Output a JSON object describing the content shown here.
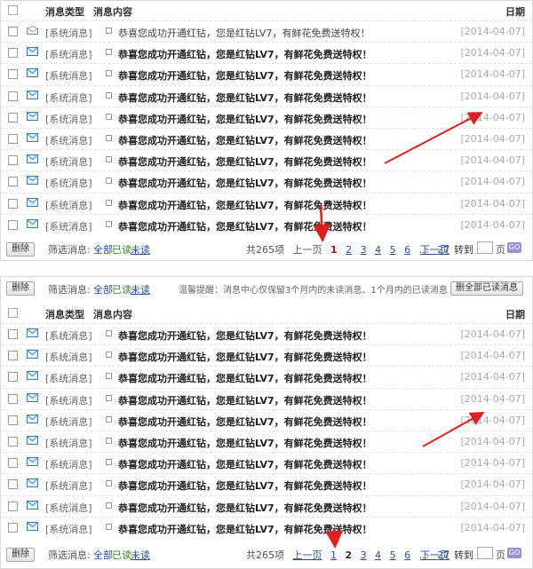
{
  "header": {
    "type": "消息类型",
    "content": "消息内容",
    "date": "日期"
  },
  "top": {
    "rows": [
      {
        "type": "[系统消息]",
        "msg": "恭喜您成功开通红钻，您是红钻LV7，有鲜花免费送特权！",
        "date": "[2014-04-07]",
        "read": true
      },
      {
        "type": "[系统消息]",
        "msg": "恭喜您成功开通红钻，您是红钻LV7，有鲜花免费送特权！",
        "date": "[2014-04-07]",
        "read": false
      },
      {
        "type": "[系统消息]",
        "msg": "恭喜您成功开通红钻，您是红钻LV7，有鲜花免费送特权！",
        "date": "[2014-04-07]",
        "read": false
      },
      {
        "type": "[系统消息]",
        "msg": "恭喜您成功开通红钻，您是红钻LV7，有鲜花免费送特权！",
        "date": "[2014-04-07]",
        "read": false
      },
      {
        "type": "[系统消息]",
        "msg": "恭喜您成功开通红钻，您是红钻LV7，有鲜花免费送特权！",
        "date": "[2014-04-07]",
        "read": false
      },
      {
        "type": "[系统消息]",
        "msg": "恭喜您成功开通红钻，您是红钻LV7，有鲜花免费送特权！",
        "date": "[2014-04-07]",
        "read": false
      },
      {
        "type": "[系统消息]",
        "msg": "恭喜您成功开通红钻，您是红钻LV7，有鲜花免费送特权！",
        "date": "[2014-04-07]",
        "read": false
      },
      {
        "type": "[系统消息]",
        "msg": "恭喜您成功开通红钻，您是红钻LV7，有鲜花免费送特权！",
        "date": "[2014-04-07]",
        "read": false
      },
      {
        "type": "[系统消息]",
        "msg": "恭喜您成功开通红钻，您是红钻LV7，有鲜花免费送特权！",
        "date": "[2014-04-07]",
        "read": false
      },
      {
        "type": "[系统消息]",
        "msg": "恭喜您成功开通红钻，您是红钻LV7，有鲜花免费送特权！",
        "date": "[2014-04-07]",
        "read": false
      }
    ],
    "footer": {
      "delete": "删除",
      "filter": "筛选消息:",
      "all": "全部",
      "read": "已读",
      "unread": "未读",
      "total": "共265项",
      "prev": "上一页",
      "pages": [
        "1",
        "2",
        "3",
        "4",
        "5",
        "6",
        "…",
        "27"
      ],
      "next": "下一页",
      "goto": "转到",
      "page": "页",
      "go": "GO"
    }
  },
  "bottom": {
    "toolbar": {
      "delete": "删除",
      "filter": "筛选消息:",
      "all": "全部",
      "read": "已读",
      "unread": "未读",
      "tip": "温馨提醒：消息中心仅保留3个月内的未读消息、1个月内的已读消息",
      "mark_all": "删全部已读消息"
    },
    "rows": [
      {
        "type": "[系统消息]",
        "msg": "恭喜您成功开通红钻，您是红钻LV7，有鲜花免费送特权！",
        "date": "[2014-04-07]",
        "read": false
      },
      {
        "type": "[系统消息]",
        "msg": "恭喜您成功开通红钻，您是红钻LV7，有鲜花免费送特权！",
        "date": "[2014-04-07]",
        "read": false
      },
      {
        "type": "[系统消息]",
        "msg": "恭喜您成功开通红钻，您是红钻LV7，有鲜花免费送特权！",
        "date": "[2014-04-07]",
        "read": false
      },
      {
        "type": "[系统消息]",
        "msg": "恭喜您成功开通红钻，您是红钻LV7，有鲜花免费送特权！",
        "date": "[2014-04-07]",
        "read": false
      },
      {
        "type": "[系统消息]",
        "msg": "恭喜您成功开通红钻，您是红钻LV7，有鲜花免费送特权！",
        "date": "[2014-04-07]",
        "read": false
      },
      {
        "type": "[系统消息]",
        "msg": "恭喜您成功开通红钻，您是红钻LV7，有鲜花免费送特权！",
        "date": "[2014-04-07]",
        "read": false
      },
      {
        "type": "[系统消息]",
        "msg": "恭喜您成功开通红钻，您是红钻LV7，有鲜花免费送特权！",
        "date": "[2014-04-07]",
        "read": false
      },
      {
        "type": "[系统消息]",
        "msg": "恭喜您成功开通红钻，您是红钻LV7，有鲜花免费送特权！",
        "date": "[2014-04-07]",
        "read": false
      },
      {
        "type": "[系统消息]",
        "msg": "恭喜您成功开通红钻，您是红钻LV7，有鲜花免费送特权！",
        "date": "[2014-04-07]",
        "read": false
      },
      {
        "type": "[系统消息]",
        "msg": "恭喜您成功开通红钻，您是红钻LV7，有鲜花免费送特权！",
        "date": "[2014-04-07]",
        "read": false
      }
    ],
    "footer": {
      "delete": "删除",
      "filter": "筛选消息:",
      "all": "全部",
      "read": "已读",
      "unread": "未读",
      "total": "共265项",
      "prev": "上一页",
      "pages": [
        "1",
        "2",
        "3",
        "4",
        "5",
        "6",
        "…",
        "27"
      ],
      "next": "下一页",
      "goto": "转到",
      "page": "页",
      "go": "GO"
    }
  },
  "colors": {
    "link": "#2b4fa3",
    "current_page": "#cc0000",
    "arrow": "#e02020",
    "date": "#aaaaaa"
  },
  "icons": {
    "row_icon": "envelope-icon",
    "annotation": "red-arrow"
  }
}
